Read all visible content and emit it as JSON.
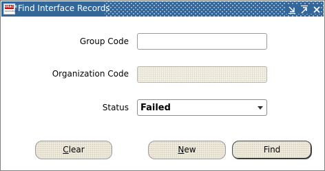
{
  "window": {
    "title": "Find Interface Records",
    "app_icon_brand": "ORACLE",
    "app_icon_sub": "Applications"
  },
  "form": {
    "group_code_label": "Group Code",
    "group_code_value": "",
    "organization_code_label": "Organization Code",
    "organization_code_value": "",
    "status_label": "Status",
    "status_value": "Failed"
  },
  "buttons": {
    "clear_mnemonic": "C",
    "clear_rest": "lear",
    "new_mnemonic": "N",
    "new_rest": "ew",
    "find_label": "Find"
  }
}
